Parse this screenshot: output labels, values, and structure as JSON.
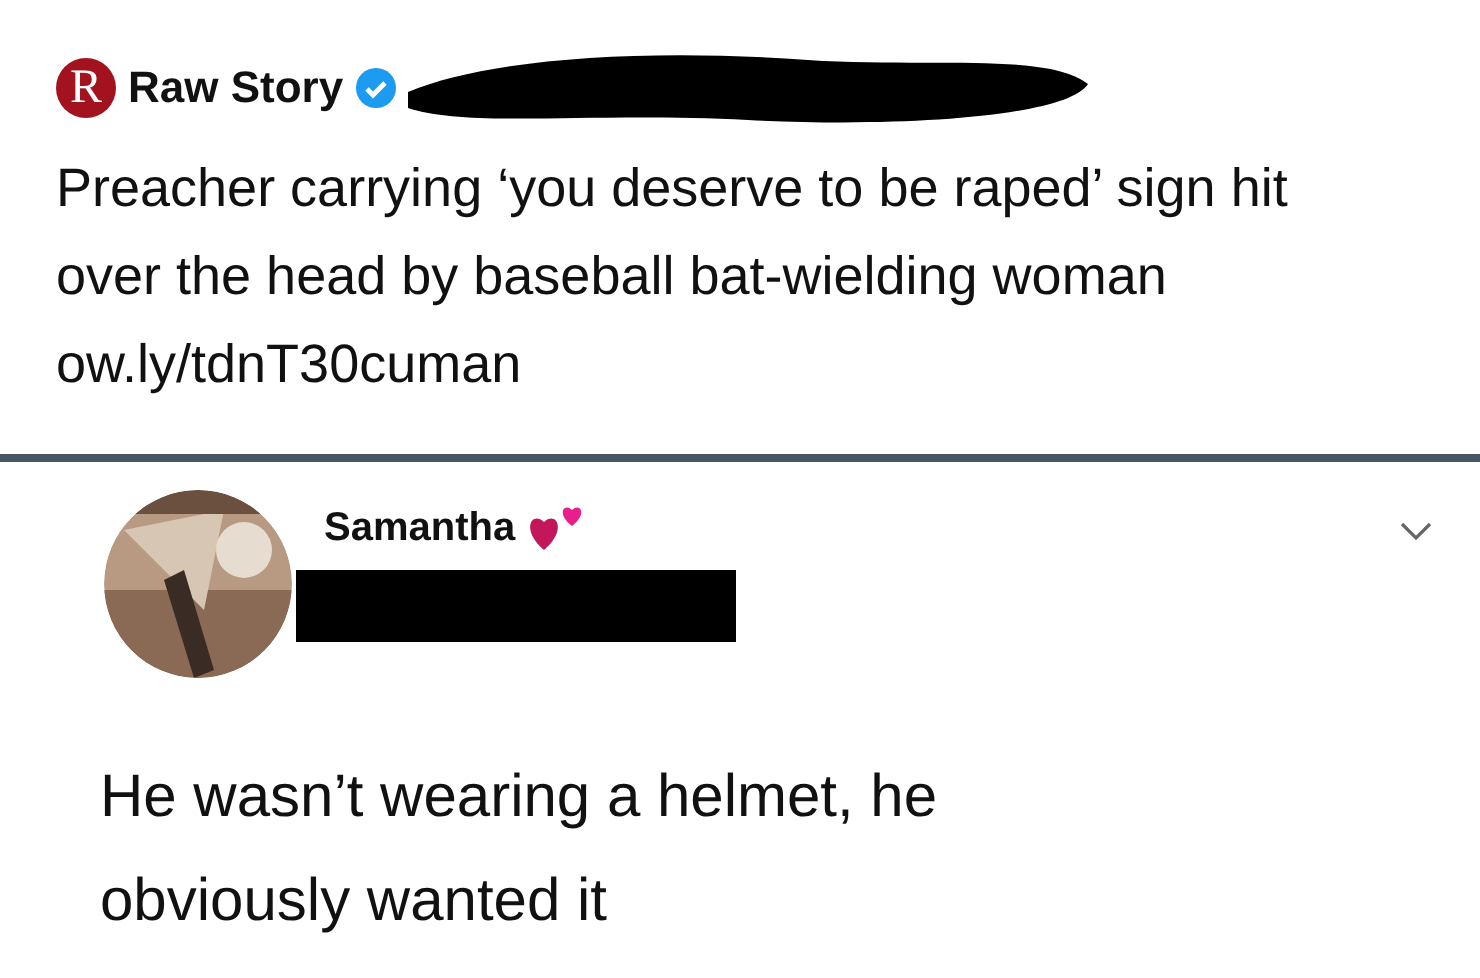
{
  "post": {
    "author": "Raw Story",
    "verified": true,
    "logo": "R",
    "text": "Preacher carrying ‘you deserve to be raped’ sign hit over the head by baseball bat-wielding woman ow.ly/tdnT30cuman"
  },
  "reply": {
    "author": "Samantha",
    "text": "He wasn’t wearing a helmet, he obviously wanted it"
  }
}
